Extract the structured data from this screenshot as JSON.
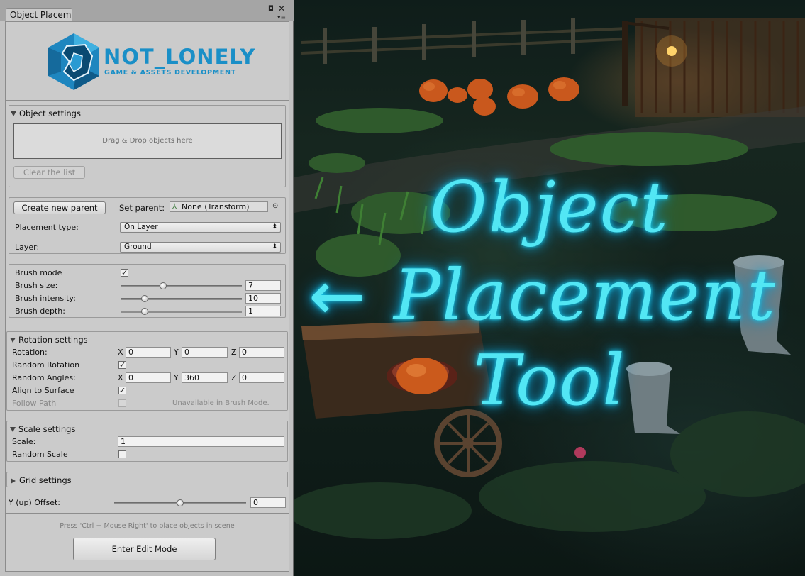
{
  "window": {
    "tab_title": "Object Placeme",
    "icons": [
      "lock-icon",
      "close-icon",
      "menu-icon"
    ]
  },
  "logo": {
    "name": "NOT_LONELY",
    "tagline": "GAME & ASSETS DEVELOPMENT"
  },
  "object_settings": {
    "header": "Object settings",
    "drop_area": "Drag & Drop objects here",
    "clear_button": "Clear the list"
  },
  "parent": {
    "create_button": "Create new parent",
    "set_parent_label": "Set parent:",
    "set_parent_value": "None (Transform)",
    "placement_type_label": "Placement type:",
    "placement_type_value": "On Layer",
    "layer_label": "Layer:",
    "layer_value": "Ground"
  },
  "brush": {
    "mode_label": "Brush mode",
    "mode_checked": true,
    "size_label": "Brush size:",
    "size_value": "7",
    "size_fraction": 0.35,
    "intensity_label": "Brush intensity:",
    "intensity_value": "10",
    "intensity_fraction": 0.2,
    "depth_label": "Brush depth:",
    "depth_value": "1",
    "depth_fraction": 0.2
  },
  "rotation": {
    "header": "Rotation settings",
    "rotation_label": "Rotation:",
    "x_label": "X",
    "y_label": "Y",
    "z_label": "Z",
    "rot_x": "0",
    "rot_y": "0",
    "rot_z": "0",
    "random_rotation_label": "Random Rotation",
    "random_rotation_checked": true,
    "random_angles_label": "Random Angles:",
    "ang_x": "0",
    "ang_y": "360",
    "ang_z": "0",
    "align_label": "Align to Surface",
    "align_checked": true,
    "follow_path_label": "Follow Path",
    "follow_path_checked": false,
    "follow_path_note": "Unavailable in Brush Mode."
  },
  "scale": {
    "header": "Scale settings",
    "scale_label": "Scale:",
    "scale_value": "1",
    "random_scale_label": "Random Scale",
    "random_scale_checked": false
  },
  "grid": {
    "header": "Grid settings"
  },
  "offset": {
    "label": "Y (up) Offset:",
    "value": "0",
    "fraction": 0.5
  },
  "footer": {
    "hint": "Press 'Ctrl + Mouse Right' to place objects in scene",
    "edit_button": "Enter Edit Mode"
  },
  "scene": {
    "line1": "Object",
    "line2": "Placement",
    "line3": "Tool",
    "arrow_glyph": "←",
    "text_color": "#52e6f4"
  }
}
